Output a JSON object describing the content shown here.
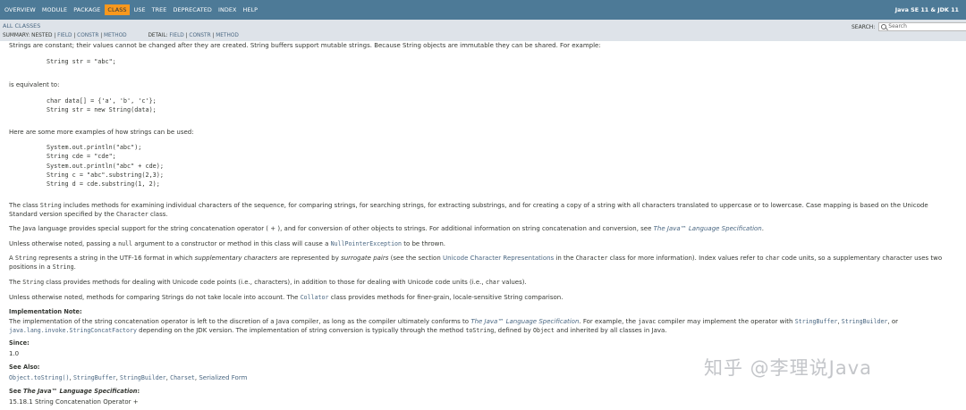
{
  "nav": {
    "items": [
      "OVERVIEW",
      "MODULE",
      "PACKAGE",
      "CLASS",
      "USE",
      "TREE",
      "DEPRECATED",
      "INDEX",
      "HELP"
    ],
    "active_index": 3,
    "brand": "Java SE 11 & JDK 11"
  },
  "subnav": {
    "all_classes": "ALL CLASSES",
    "summary_prefix": "SUMMARY: NESTED |",
    "summary_field": "FIELD",
    "summary_constr": "CONSTR",
    "summary_method": "METHOD",
    "sep": "|",
    "detail_prefix": "DETAIL:",
    "detail_field": "FIELD",
    "detail_constr": "CONSTR",
    "detail_method": "METHOD",
    "search_label": "SEARCH:",
    "search_placeholder": "Search"
  },
  "doc": {
    "p1": "Strings are constant; their values cannot be changed after they are created. String buffers support mutable strings. Because String objects are immutable they can be shared. For example:",
    "code1": "String str = \"abc\";",
    "p2": "is equivalent to:",
    "code2": "char data[] = {'a', 'b', 'c'};\nString str = new String(data);",
    "p3": "Here are some more examples of how strings can be used:",
    "code3": "System.out.println(\"abc\");\nString cde = \"cde\";\nSystem.out.println(\"abc\" + cde);\nString c = \"abc\".substring(2,3);\nString d = cde.substring(1, 2);",
    "p4a": "The class ",
    "p4_String": "String",
    "p4b": " includes methods for examining individual characters of the sequence, for comparing strings, for searching strings, for extracting substrings, and for creating a copy of a string with all characters translated to uppercase or to lowercase. Case mapping is based on the Unicode Standard version specified by the ",
    "p4_Character": "Character",
    "p4c": " class.",
    "p5a": "The Java language provides special support for the string concatenation operator ( + ), and for conversion of other objects to strings. For additional information on string concatenation and conversion, see ",
    "p5_spec": "The Java™ Language Specification",
    "p5b": ".",
    "p6a": "Unless otherwise noted, passing a ",
    "p6_null": "null",
    "p6b": " argument to a constructor or method in this class will cause a ",
    "p6_npe": "NullPointerException",
    "p6c": " to be thrown.",
    "p7a": "A ",
    "p7_String": "String",
    "p7b": " represents a string in the UTF-16 format in which ",
    "p7_supp": "supplementary characters",
    "p7c": " are represented by ",
    "p7_surr": "surrogate pairs",
    "p7d": " (see the section ",
    "p7_ucr": "Unicode Character Representations",
    "p7e": " in the ",
    "p7_Character": "Character",
    "p7f": " class for more information). Index values refer to ",
    "p7_char": "char",
    "p7g": " code units, so a supplementary character uses two positions in a ",
    "p7_String2": "String",
    "p7h": ".",
    "p8a": "The ",
    "p8_String": "String",
    "p8b": " class provides methods for dealing with Unicode code points (i.e., characters), in addition to those for dealing with Unicode code units (i.e., ",
    "p8_char": "char",
    "p8c": " values).",
    "p9a": "Unless otherwise noted, methods for comparing Strings do not take locale into account. The ",
    "p9_collator": "Collator",
    "p9b": " class provides methods for finer-grain, locale-sensitive String comparison.",
    "impl_label": "Implementation Note:",
    "impl_a": "The implementation of the string concatenation operator is left to the discretion of a Java compiler, as long as the compiler ultimately conforms to ",
    "impl_spec": "The Java™ Language Specification",
    "impl_b": ". For example, the ",
    "impl_javac": "javac",
    "impl_c": " compiler may implement the operator with ",
    "impl_sb": "StringBuffer",
    "impl_comma1": ", ",
    "impl_sbl": "StringBuilder",
    "impl_or": ", or ",
    "impl_scf": "java.lang.invoke.StringConcatFactory",
    "impl_d": " depending on the JDK version. The implementation of string conversion is typically through the method ",
    "impl_tostring": "toString",
    "impl_e": ", defined by ",
    "impl_object": "Object",
    "impl_f": " and inherited by all classes in Java.",
    "since_label": "Since:",
    "since_value": "1.0",
    "seealso_label": "See Also:",
    "seealso_tostring": "Object.toString()",
    "seealso_sep1": ", ",
    "seealso_sb": "StringBuffer",
    "seealso_sep2": ", ",
    "seealso_sbl": "StringBuilder",
    "seealso_sep3": ", ",
    "seealso_charset": "Charset",
    "seealso_sep4": ", ",
    "seealso_sf": "Serialized Form",
    "seejls_label_a": "See ",
    "seejls_label_spec": "The Java™ Language Specification",
    "seejls_label_b": ":",
    "seejls_value": "15.18.1 String Concatenation Operator +"
  },
  "watermark": "知乎 @李理说Java"
}
